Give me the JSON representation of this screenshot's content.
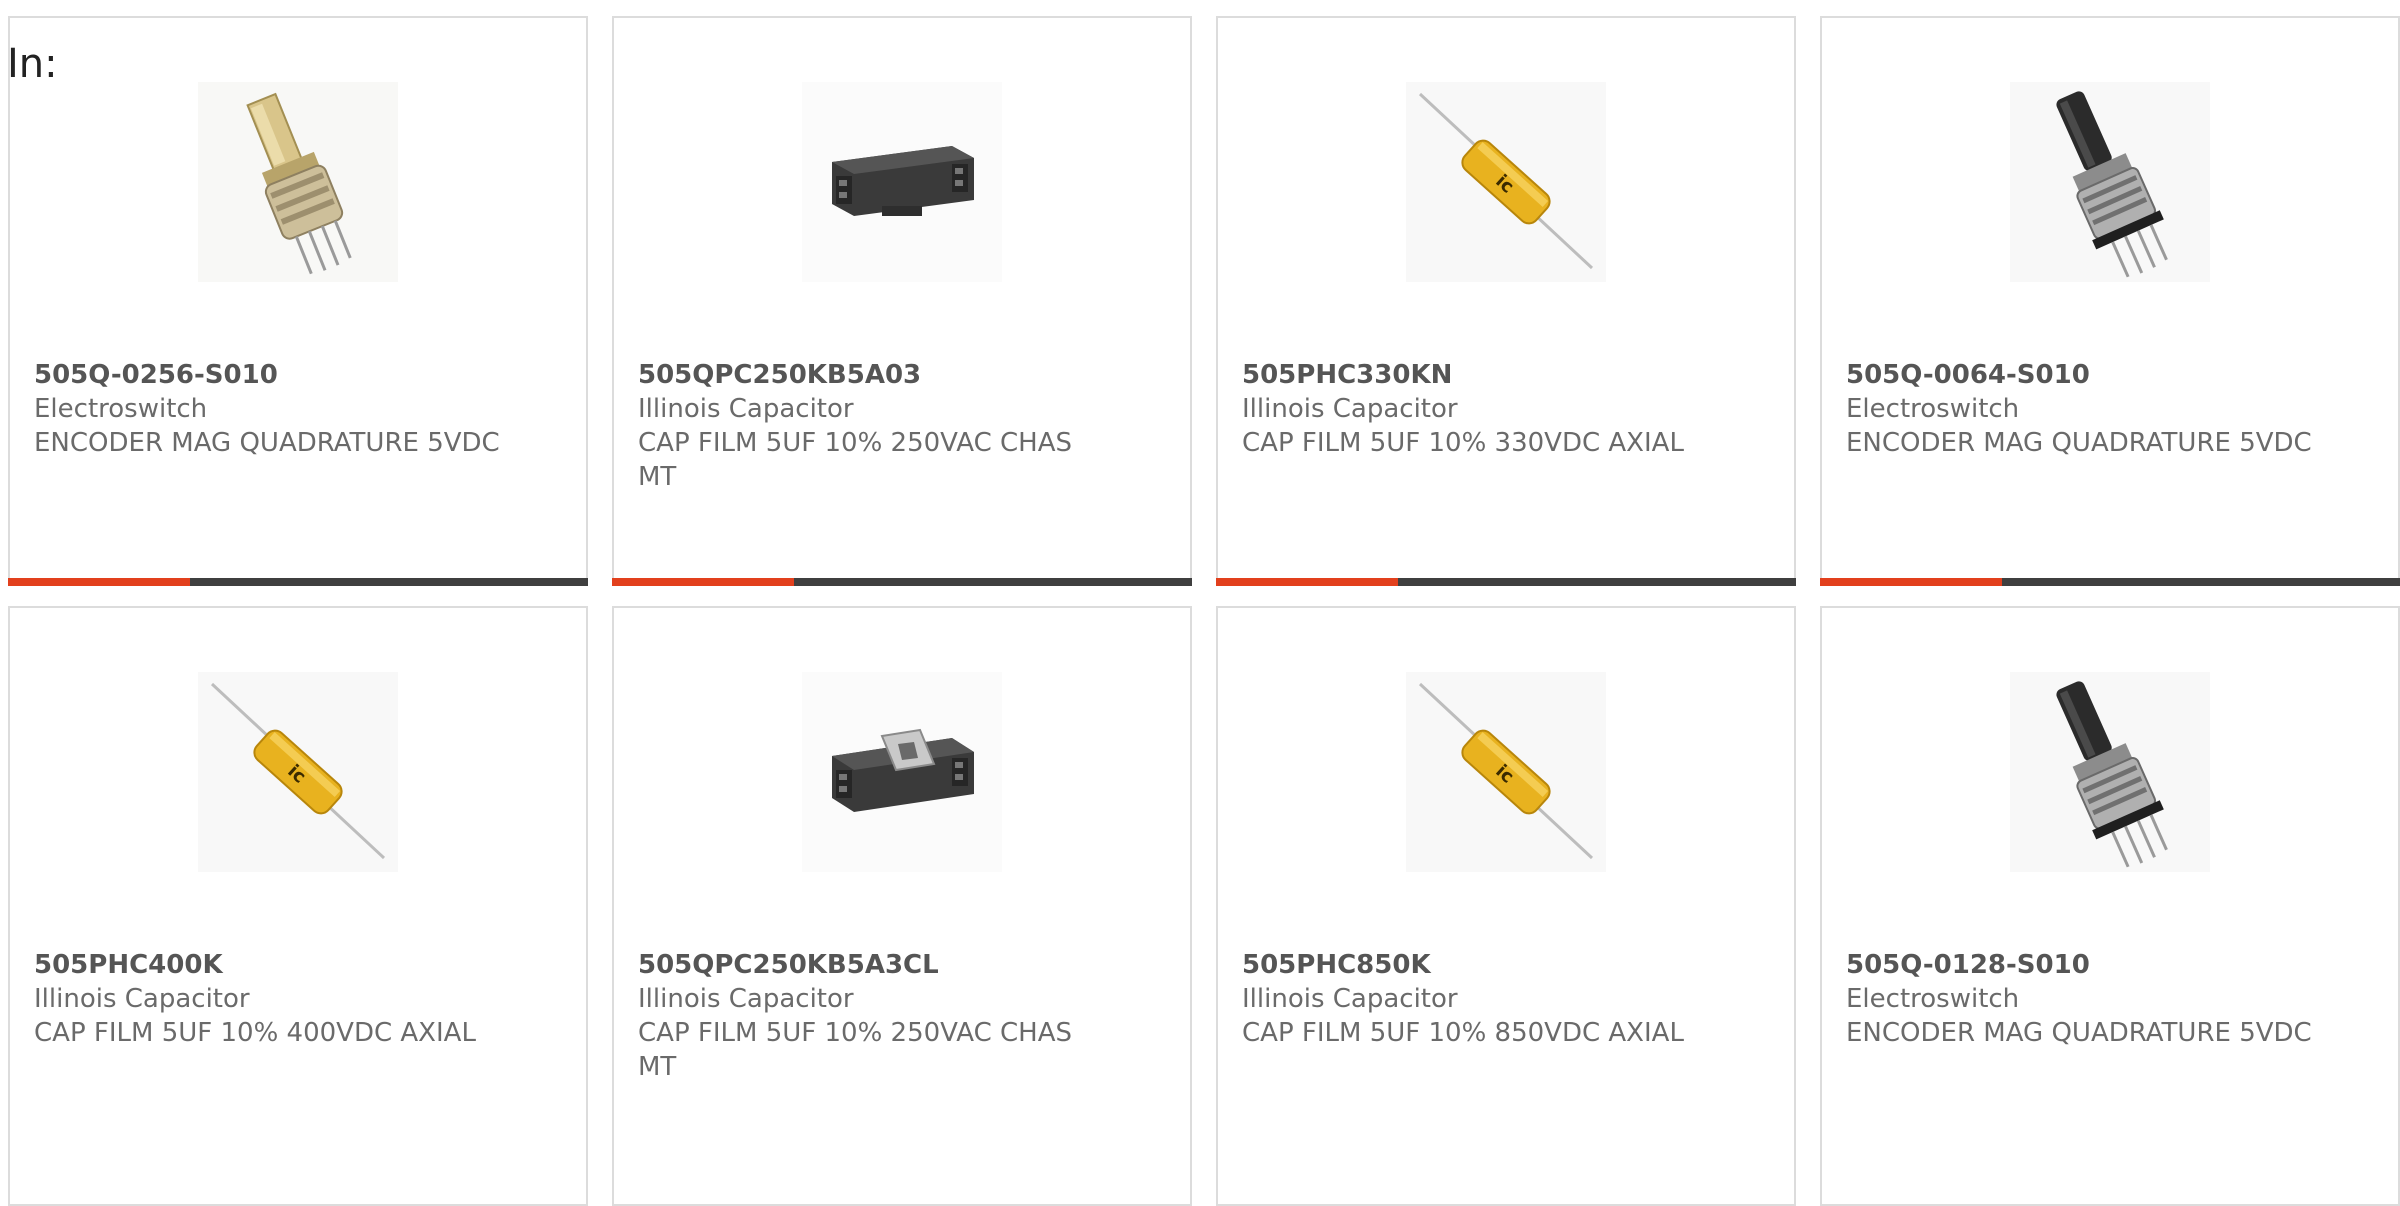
{
  "filter_prefix": "In:",
  "colors": {
    "accent": "#e2401d",
    "bar": "#3f3f3f",
    "border": "#dcdcdc"
  },
  "products": [
    {
      "part_number": "505Q-0256-S010",
      "manufacturer": "Electroswitch",
      "description": "ENCODER MAG QUADRATURE 5VDC",
      "icon": "encoder-brass-icon"
    },
    {
      "part_number": "505QPC250KB5A03",
      "manufacturer": "Illinois Capacitor",
      "description": "CAP FILM 5UF 10% 250VAC CHAS MT",
      "icon": "chassis-capacitor-icon"
    },
    {
      "part_number": "505PHC330KN",
      "manufacturer": "Illinois Capacitor",
      "description": "CAP FILM 5UF 10% 330VDC AXIAL",
      "icon": "axial-capacitor-icon"
    },
    {
      "part_number": "505Q-0064-S010",
      "manufacturer": "Electroswitch",
      "description": "ENCODER MAG QUADRATURE 5VDC",
      "icon": "encoder-black-icon"
    },
    {
      "part_number": "505PHC400K",
      "manufacturer": "Illinois Capacitor",
      "description": "CAP FILM 5UF 10% 400VDC AXIAL",
      "icon": "axial-capacitor-icon"
    },
    {
      "part_number": "505QPC250KB5A3CL",
      "manufacturer": "Illinois Capacitor",
      "description": "CAP FILM 5UF 10% 250VAC CHAS MT",
      "icon": "chassis-capacitor-clip-icon"
    },
    {
      "part_number": "505PHC850K",
      "manufacturer": "Illinois Capacitor",
      "description": "CAP FILM 5UF 10% 850VDC AXIAL",
      "icon": "axial-capacitor-icon"
    },
    {
      "part_number": "505Q-0128-S010",
      "manufacturer": "Electroswitch",
      "description": "ENCODER MAG QUADRATURE 5VDC",
      "icon": "encoder-black-icon"
    }
  ]
}
